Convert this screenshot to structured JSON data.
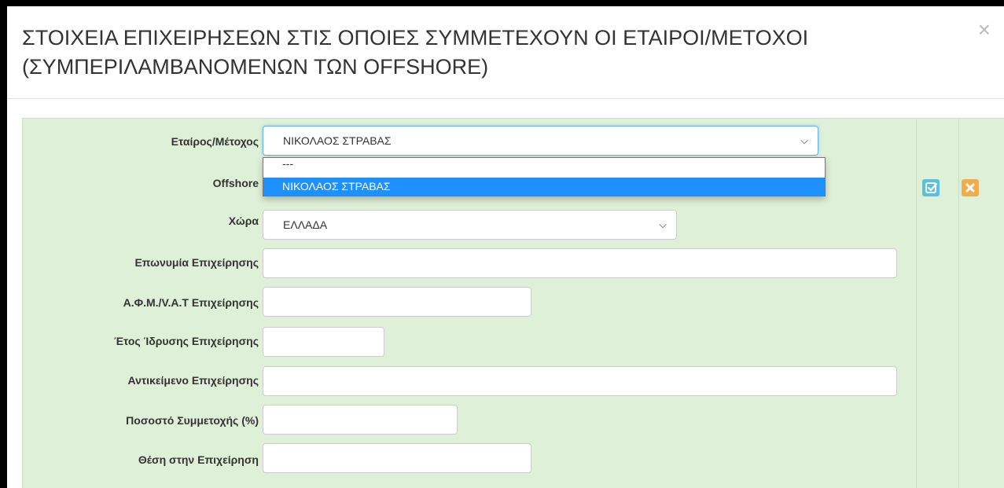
{
  "modal": {
    "title": "ΣΤΟΙΧΕΙΑ ΕΠΙΧΕΙΡΗΣΕΩΝ ΣΤΙΣ ΟΠΟΙΕΣ ΣΥΜΜΕΤΕΧΟΥΝ ΟΙ ΕΤΑΙΡΟΙ/ΜΕΤΟΧΟΙ (ΣΥΜΠΕΡΙΛΑΜΒΑΝΟΜΕΝΩΝ ΤΩΝ OFFSHORE)",
    "close_label": "×"
  },
  "form": {
    "partner": {
      "label": "Εταίρος/Μέτοχος",
      "value": "ΝΙΚΟΛΑΟΣ ΣΤΡΑΒΑΣ",
      "options": [
        "---",
        "ΝΙΚΟΛΑΟΣ ΣΤΡΑΒΑΣ"
      ]
    },
    "offshore": {
      "label": "Offshore"
    },
    "country": {
      "label": "Χώρα",
      "value": "ΕΛΛΑΔΑ"
    },
    "company_name": {
      "label": "Επωνυμία Επιχείρησης",
      "value": ""
    },
    "vat": {
      "label": "Α.Φ.Μ./V.A.T Επιχείρησης",
      "value": ""
    },
    "founding_year": {
      "label": "Έτος Ίδρυσης Επιχείρησης",
      "value": ""
    },
    "business_object": {
      "label": "Αντικείμενο Επιχείρησης",
      "value": ""
    },
    "participation": {
      "label": "Ποσοστό Συμμετοχής (%)",
      "value": ""
    },
    "position": {
      "label": "Θέση στην Επιχείρηση",
      "value": ""
    }
  },
  "icons": {
    "chevron": "chevron-down-icon",
    "edit": "edit-check-icon",
    "delete": "delete-x-icon"
  },
  "colors": {
    "row_background": "#dff0d8",
    "edit_button": "#5bc0de",
    "delete_button": "#f0ad4e",
    "selected_option": "#1e90ff"
  }
}
